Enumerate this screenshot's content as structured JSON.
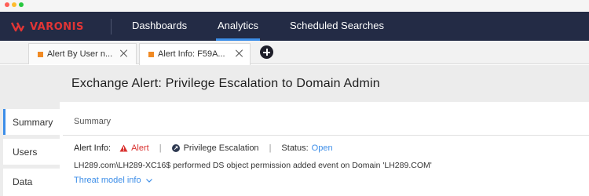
{
  "topnav": {
    "brand": "VARONIS",
    "items": [
      {
        "label": "Dashboards",
        "active": false
      },
      {
        "label": "Analytics",
        "active": true
      },
      {
        "label": "Scheduled Searches",
        "active": false
      }
    ]
  },
  "tabs": [
    {
      "label": "Alert By User n..."
    },
    {
      "label": "Alert Info: F59A..."
    }
  ],
  "page": {
    "title": "Exchange Alert: Privilege Escalation to Domain Admin"
  },
  "sidebar": {
    "items": [
      {
        "label": "Summary",
        "active": true
      },
      {
        "label": "Users",
        "active": false
      },
      {
        "label": "Data",
        "active": false
      }
    ]
  },
  "summary": {
    "section_title": "Summary",
    "alert_info_label": "Alert Info:",
    "alert_type": "Alert",
    "category": "Privilege Escalation",
    "status_label": "Status:",
    "status_value": "Open",
    "description": "LH289.com\\LH289-XC16$ performed DS object permission added event on Domain 'LH289.COM'",
    "threat_model_link": "Threat model info"
  },
  "colors": {
    "nav_bg": "#232b45",
    "accent": "#3d8ee8",
    "alert_red": "#d9312f",
    "brand_red": "#e23535",
    "tab_marker": "#f08a24"
  }
}
